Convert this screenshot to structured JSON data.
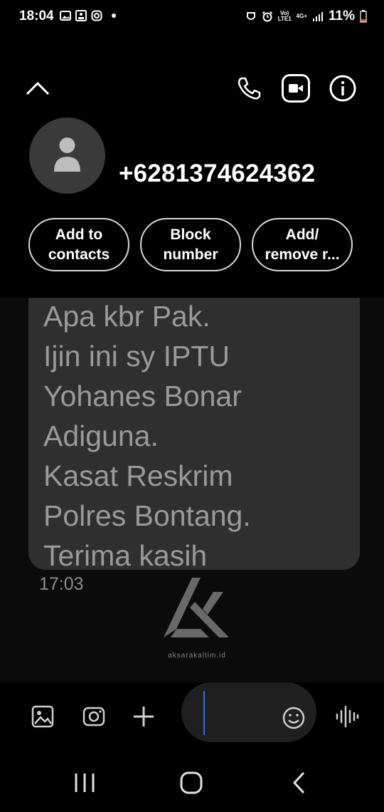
{
  "status_bar": {
    "time": "18:04",
    "battery": "11%",
    "network_top": "Vo)",
    "network_bottom": "LTE1",
    "network_type": "4G+",
    "left_icons": [
      "gallery-icon",
      "photo-icon",
      "instagram-icon",
      "dot-icon"
    ],
    "right_icons": [
      "mask-icon",
      "alarm-icon",
      "signal-icon",
      "battery-icon"
    ]
  },
  "header": {
    "phone_number": "+6281374624362",
    "actions": [
      {
        "name": "add-to-contacts",
        "label": "Add to\ncontacts"
      },
      {
        "name": "block-number",
        "label": "Block\nnumber"
      },
      {
        "name": "add-remove",
        "label": "Add/\nremove r..."
      }
    ],
    "icons": [
      "chevron-up-icon",
      "phone-call-icon",
      "video-call-icon",
      "info-icon"
    ]
  },
  "conversation": {
    "message_text": "Apa kbr Pak.\nIjin ini sy IPTU\nYohanes Bonar\nAdiguna.\nKasat Reskrim\nPolres Bontang.\nTerima kasih",
    "message_time": "17:03",
    "watermark_text": "aksarakaltim.id"
  },
  "composer": {
    "icons": [
      "gallery-icon",
      "camera-icon",
      "plus-icon",
      "emoji-icon",
      "voice-wave-icon"
    ]
  },
  "nav": {
    "icons": [
      "recents-icon",
      "home-icon",
      "back-icon"
    ]
  },
  "colors": {
    "background": "#000000",
    "bubble": "#2f2f2f",
    "message_text": "#9a9a9a",
    "cursor": "#2f6fe0"
  }
}
